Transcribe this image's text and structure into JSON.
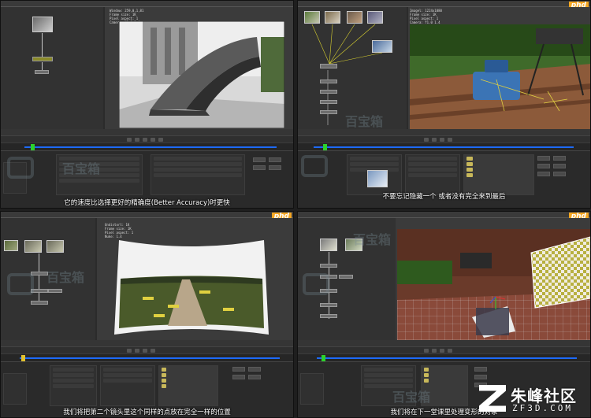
{
  "panels": [
    {
      "id": "q1",
      "subtitle": "它的速度比选择更好的精确度(Better Accuracy)时更快",
      "readout": [
        "Window: 259,0,1,81",
        "Frame size: 1K",
        "Pixel aspect: 1",
        "Camera: f1.0 1.4"
      ],
      "tab": "Time Dist"
    },
    {
      "id": "q2",
      "subtitle": "不要忘记隐藏一个 或者没有完全来到最后",
      "readout": [
        "Imagel: 1224x1080",
        "Frame size: 1K",
        "Pixel aspect: 1",
        "Camera: f1.0 1.4"
      ],
      "tab": "Tree Term"
    },
    {
      "id": "q3",
      "subtitle": "我们将把第二个镜头里这个同样的点放在完全一样的位置",
      "readout": [
        "Undistort: 1K",
        "Frame size: 1K",
        "Pixel aspect: 1",
        "Nuke: 1.4"
      ],
      "tab": "Time Dist"
    },
    {
      "id": "q4",
      "subtitle": "我们将在下一堂课里处理变形的对象",
      "readout": [],
      "tab": "Tree Dist"
    }
  ],
  "logo": {
    "phd": "phd"
  },
  "brand": {
    "cn": "朱峰社区",
    "en": "ZF3D.COM"
  },
  "watermark": {
    "text": "百宝箱"
  },
  "colors": {
    "timeline": "#1d6aff",
    "playhead": "#2cd12c",
    "phd": "#f5a623"
  }
}
